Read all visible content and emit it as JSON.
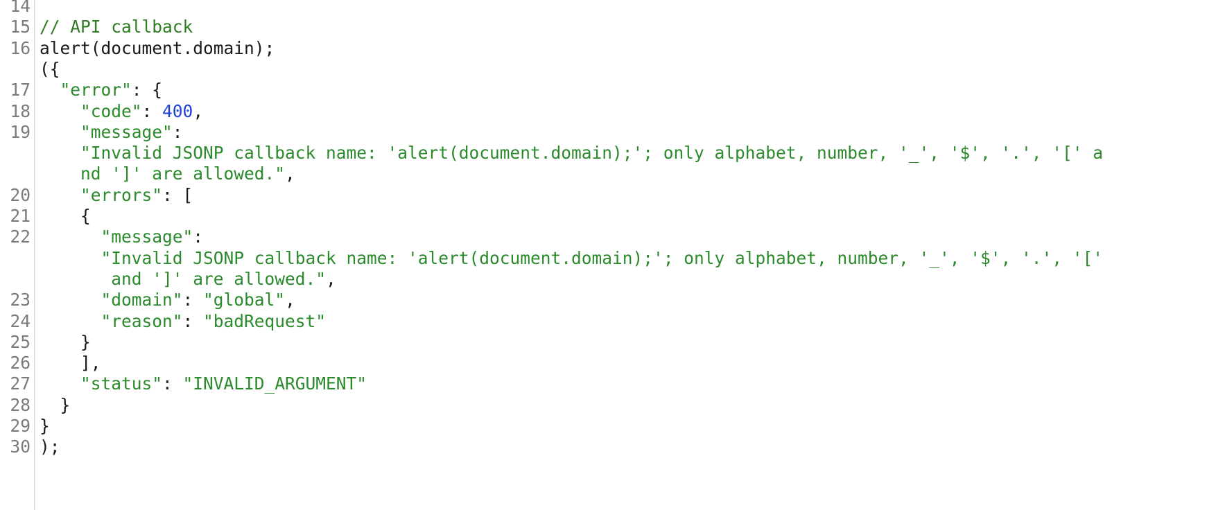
{
  "editor": {
    "lines": [
      {
        "num": "14",
        "segments": []
      },
      {
        "num": "15",
        "segments": [
          {
            "t": "comment",
            "text": "// API callback"
          }
        ]
      },
      {
        "num": "16",
        "segments": [
          {
            "t": "plain",
            "text": "alert(document.domain);"
          }
        ]
      },
      {
        "num": "",
        "segments": [
          {
            "t": "plain",
            "text": "({"
          }
        ]
      },
      {
        "num": "17",
        "segments": [
          {
            "t": "plain",
            "text": "  "
          },
          {
            "t": "str",
            "text": "\"error\""
          },
          {
            "t": "plain",
            "text": ": {"
          }
        ]
      },
      {
        "num": "18",
        "segments": [
          {
            "t": "plain",
            "text": "    "
          },
          {
            "t": "str",
            "text": "\"code\""
          },
          {
            "t": "plain",
            "text": ": "
          },
          {
            "t": "num",
            "text": "400"
          },
          {
            "t": "plain",
            "text": ","
          }
        ]
      },
      {
        "num": "19",
        "segments": [
          {
            "t": "plain",
            "text": "    "
          },
          {
            "t": "str",
            "text": "\"message\""
          },
          {
            "t": "plain",
            "text": ":"
          }
        ]
      },
      {
        "num": "",
        "segments": [
          {
            "t": "plain",
            "text": "    "
          },
          {
            "t": "str",
            "text": "\"Invalid JSONP callback name: 'alert(document.domain);'; only alphabet, number, '_', '$', '.', '[' a"
          }
        ]
      },
      {
        "num": "",
        "segments": [
          {
            "t": "plain",
            "text": "    "
          },
          {
            "t": "str",
            "text": "nd ']' are allowed.\""
          },
          {
            "t": "plain",
            "text": ","
          }
        ]
      },
      {
        "num": "20",
        "segments": [
          {
            "t": "plain",
            "text": "    "
          },
          {
            "t": "str",
            "text": "\"errors\""
          },
          {
            "t": "plain",
            "text": ": ["
          }
        ]
      },
      {
        "num": "21",
        "segments": [
          {
            "t": "plain",
            "text": "    {"
          }
        ]
      },
      {
        "num": "22",
        "segments": [
          {
            "t": "plain",
            "text": "      "
          },
          {
            "t": "str",
            "text": "\"message\""
          },
          {
            "t": "plain",
            "text": ":"
          }
        ]
      },
      {
        "num": "",
        "segments": [
          {
            "t": "plain",
            "text": "      "
          },
          {
            "t": "str",
            "text": "\"Invalid JSONP callback name: 'alert(document.domain);'; only alphabet, number, '_', '$', '.', '['"
          }
        ]
      },
      {
        "num": "",
        "segments": [
          {
            "t": "plain",
            "text": "       "
          },
          {
            "t": "str",
            "text": "and ']' are allowed.\""
          },
          {
            "t": "plain",
            "text": ","
          }
        ]
      },
      {
        "num": "23",
        "segments": [
          {
            "t": "plain",
            "text": "      "
          },
          {
            "t": "str",
            "text": "\"domain\""
          },
          {
            "t": "plain",
            "text": ": "
          },
          {
            "t": "str",
            "text": "\"global\""
          },
          {
            "t": "plain",
            "text": ","
          }
        ]
      },
      {
        "num": "24",
        "segments": [
          {
            "t": "plain",
            "text": "      "
          },
          {
            "t": "str",
            "text": "\"reason\""
          },
          {
            "t": "plain",
            "text": ": "
          },
          {
            "t": "str",
            "text": "\"badRequest\""
          }
        ]
      },
      {
        "num": "25",
        "segments": [
          {
            "t": "plain",
            "text": "    }"
          }
        ]
      },
      {
        "num": "26",
        "segments": [
          {
            "t": "plain",
            "text": "    ],"
          }
        ]
      },
      {
        "num": "27",
        "segments": [
          {
            "t": "plain",
            "text": "    "
          },
          {
            "t": "str",
            "text": "\"status\""
          },
          {
            "t": "plain",
            "text": ": "
          },
          {
            "t": "str",
            "text": "\"INVALID_ARGUMENT\""
          }
        ]
      },
      {
        "num": "28",
        "segments": [
          {
            "t": "plain",
            "text": "  }"
          }
        ]
      },
      {
        "num": "29",
        "segments": [
          {
            "t": "plain",
            "text": "}"
          }
        ]
      },
      {
        "num": "30",
        "segments": [
          {
            "t": "plain",
            "text": ");"
          }
        ]
      }
    ]
  }
}
